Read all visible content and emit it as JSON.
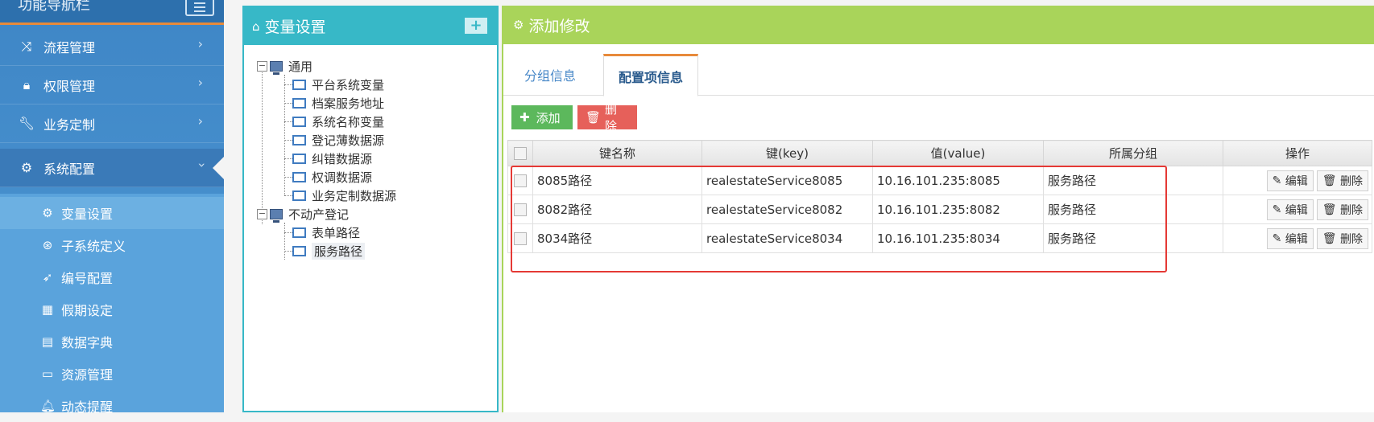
{
  "sidebar": {
    "header_title": "功能导航栏",
    "menu": [
      {
        "label": "流程管理",
        "icon": "shuffle-icon"
      },
      {
        "label": "权限管理",
        "icon": "lock-icon"
      },
      {
        "label": "业务定制",
        "icon": "wrench-icon"
      },
      {
        "label": "系统配置",
        "icon": "gear-icon"
      }
    ],
    "submenu": [
      {
        "label": "变量设置",
        "icon": "gear-icon"
      },
      {
        "label": "子系统定义",
        "icon": "globe-icon"
      },
      {
        "label": "编号配置",
        "icon": "rocket-icon"
      },
      {
        "label": "假期设定",
        "icon": "calendar-icon"
      },
      {
        "label": "数据字典",
        "icon": "book-icon"
      },
      {
        "label": "资源管理",
        "icon": "folder-icon"
      },
      {
        "label": "动态提醒",
        "icon": "bell-icon"
      }
    ]
  },
  "tree_panel": {
    "title": "变量设置",
    "add_label": "+",
    "groups": [
      {
        "label": "通用",
        "children": [
          "平台系统变量",
          "档案服务地址",
          "系统名称变量",
          "登记薄数据源",
          "纠错数据源",
          "权调数据源",
          "业务定制数据源"
        ]
      },
      {
        "label": "不动产登记",
        "children": [
          "表单路径",
          "服务路径"
        ]
      }
    ]
  },
  "main_panel": {
    "title": "添加修改",
    "tabs": [
      "分组信息",
      "配置项信息"
    ],
    "active_tab": 1,
    "add_button": "添加",
    "delete_button": "删除",
    "table": {
      "headers": [
        "键名称",
        "键(key)",
        "值(value)",
        "所属分组",
        "操作"
      ],
      "rows": [
        {
          "name": "8085路径",
          "key": "realestateService8085",
          "value": "10.16.101.235:8085",
          "group": "服务路径"
        },
        {
          "name": "8082路径",
          "key": "realestateService8082",
          "value": "10.16.101.235:8082",
          "group": "服务路径"
        },
        {
          "name": "8034路径",
          "key": "realestateService8034",
          "value": "10.16.101.235:8034",
          "group": "服务路径"
        }
      ],
      "edit_label": "编辑",
      "delete_label": "删除"
    }
  },
  "colors": {
    "tree_header": "#37b8c7",
    "main_header": "#a9d45a",
    "sidebar": "#4c98d4",
    "highlight": "#e53935"
  }
}
